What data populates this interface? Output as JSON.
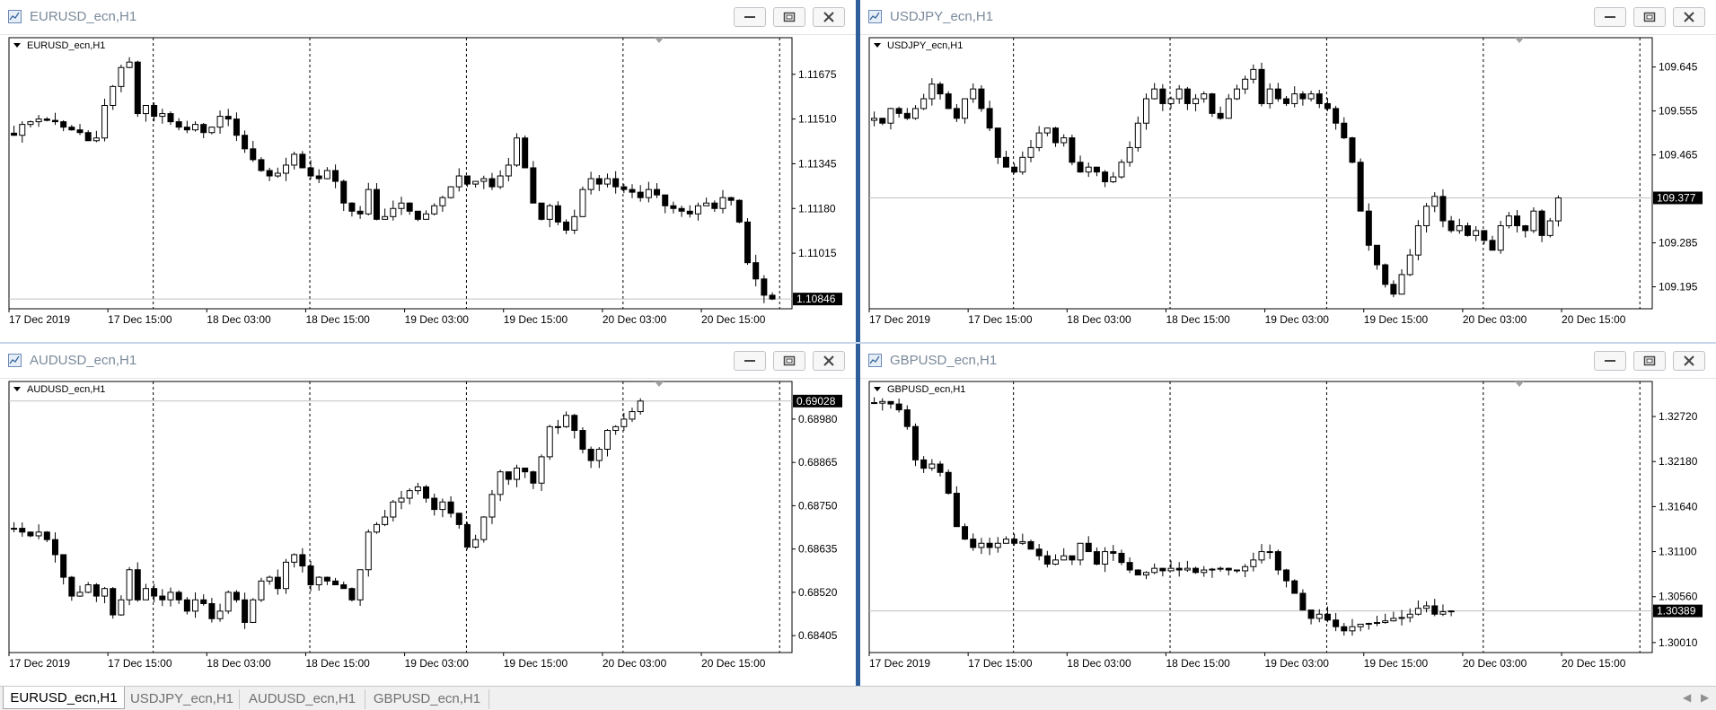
{
  "windows": [
    {
      "title": "EURUSD_ecn,H1",
      "chart_label": "EURUSD_ecn,H1",
      "current_price": "1.10846",
      "price_ticks": [
        "1.11675",
        "1.11510",
        "1.11345",
        "1.11180",
        "1.11015"
      ],
      "time_ticks": [
        "17 Dec 2019",
        "17 Dec 15:00",
        "18 Dec 03:00",
        "18 Dec 15:00",
        "19 Dec 03:00",
        "19 Dec 15:00",
        "20 Dec 03:00",
        "20 Dec 15:00"
      ]
    },
    {
      "title": "USDJPY_ecn,H1",
      "chart_label": "USDJPY_ecn,H1",
      "current_price": "109.377",
      "price_ticks": [
        "109.645",
        "109.555",
        "109.465",
        "109.285",
        "109.195"
      ],
      "time_ticks": [
        "17 Dec 2019",
        "17 Dec 15:00",
        "18 Dec 03:00",
        "18 Dec 15:00",
        "19 Dec 03:00",
        "19 Dec 15:00",
        "20 Dec 03:00",
        "20 Dec 15:00"
      ]
    },
    {
      "title": "AUDUSD_ecn,H1",
      "chart_label": "AUDUSD_ecn,H1",
      "current_price": "0.69028",
      "price_ticks": [
        "0.68980",
        "0.68865",
        "0.68750",
        "0.68635",
        "0.68520",
        "0.68405"
      ],
      "time_ticks": [
        "17 Dec 2019",
        "17 Dec 15:00",
        "18 Dec 03:00",
        "18 Dec 15:00",
        "19 Dec 03:00",
        "19 Dec 15:00",
        "20 Dec 03:00",
        "20 Dec 15:00"
      ]
    },
    {
      "title": "GBPUSD_ecn,H1",
      "chart_label": "GBPUSD_ecn,H1",
      "current_price": "1.30389",
      "price_ticks": [
        "1.32720",
        "1.32180",
        "1.31640",
        "1.31100",
        "1.30560",
        "1.30010"
      ],
      "time_ticks": [
        "17 Dec 2019",
        "17 Dec 15:00",
        "18 Dec 03:00",
        "18 Dec 15:00",
        "19 Dec 03:00",
        "19 Dec 15:00",
        "20 Dec 03:00",
        "20 Dec 15:00"
      ]
    }
  ],
  "tabs": [
    "EURUSD_ecn,H1",
    "USDJPY_ecn,H1",
    "AUDUSD_ecn,H1",
    "GBPUSD_ecn,H1"
  ],
  "active_tab": 0,
  "colors": {
    "accent": "#2f5f9a",
    "candle": "#000000",
    "grid": "#000000",
    "background": "#ffffff"
  },
  "icons": [
    "chart-window-icon",
    "minimize-icon",
    "restore-icon",
    "close-icon",
    "collapse-triangle-icon"
  ],
  "chart_data": [
    {
      "type": "candlestick",
      "series": [
        {
          "name": "EURUSD_ecn,H1",
          "close": [
            1.1145,
            1.1149,
            1.115,
            1.1151,
            1.11505,
            1.115,
            1.1148,
            1.1147,
            1.1146,
            1.1143,
            1.1144,
            1.1156,
            1.1163,
            1.117,
            1.1172,
            1.1153,
            1.1156,
            1.1152,
            1.1153,
            1.115,
            1.1148,
            1.1147,
            1.1149,
            1.1146,
            1.1148,
            1.1152,
            1.1151,
            1.1145,
            1.114,
            1.1136,
            1.1132,
            1.113,
            1.1131,
            1.1134,
            1.1138,
            1.1133,
            1.113,
            1.1129,
            1.1132,
            1.1128,
            1.112,
            1.1117,
            1.1116,
            1.1125,
            1.1114,
            1.1115,
            1.1118,
            1.112,
            1.1117,
            1.1114,
            1.1116,
            1.1119,
            1.1122,
            1.1126,
            1.113,
            1.1127,
            1.1128,
            1.1129,
            1.1126,
            1.113,
            1.1134,
            1.1144,
            1.1133,
            1.112,
            1.1114,
            1.1119,
            1.1113,
            1.111,
            1.1115,
            1.1125,
            1.1129,
            1.1127,
            1.1129,
            1.1126,
            1.1125,
            1.1124,
            1.1122,
            1.1125,
            1.1123,
            1.1119,
            1.1118,
            1.1117,
            1.1116,
            1.1119,
            1.112,
            1.1118,
            1.1122,
            1.1121,
            1.1113,
            1.1098,
            1.1092,
            1.1086,
            1.10846
          ]
        }
      ],
      "ylim": [
        1.1081,
        1.1181
      ],
      "x_labels": [
        "17 Dec 2019",
        "17 Dec 15:00",
        "18 Dec 03:00",
        "18 Dec 15:00",
        "19 Dec 03:00",
        "19 Dec 15:00",
        "20 Dec 03:00",
        "20 Dec 15:00"
      ]
    },
    {
      "type": "candlestick",
      "series": [
        {
          "name": "USDJPY_ecn,H1",
          "close": [
            109.54,
            109.53,
            109.56,
            109.55,
            109.54,
            109.56,
            109.58,
            109.61,
            109.59,
            109.56,
            109.54,
            109.58,
            109.6,
            109.56,
            109.52,
            109.46,
            109.44,
            109.43,
            109.46,
            109.48,
            109.51,
            109.52,
            109.49,
            109.5,
            109.45,
            109.43,
            109.44,
            109.43,
            109.41,
            109.42,
            109.45,
            109.48,
            109.53,
            109.58,
            109.6,
            109.57,
            109.58,
            109.6,
            109.57,
            109.58,
            109.59,
            109.55,
            109.54,
            109.58,
            109.6,
            109.62,
            109.64,
            109.57,
            109.6,
            109.58,
            109.57,
            109.59,
            109.58,
            109.59,
            109.57,
            109.56,
            109.53,
            109.5,
            109.45,
            109.35,
            109.28,
            109.24,
            109.2,
            109.18,
            109.22,
            109.26,
            109.32,
            109.36,
            109.38,
            109.33,
            109.31,
            109.32,
            109.3,
            109.31,
            109.29,
            109.27,
            109.32,
            109.34,
            109.32,
            109.31,
            109.35,
            109.3,
            109.33,
            109.377
          ]
        }
      ],
      "ylim": [
        109.15,
        109.705
      ],
      "x_labels": [
        "17 Dec 2019",
        "17 Dec 15:00",
        "18 Dec 03:00",
        "18 Dec 15:00",
        "19 Dec 03:00",
        "19 Dec 15:00",
        "20 Dec 03:00",
        "20 Dec 15:00"
      ]
    },
    {
      "type": "candlestick",
      "series": [
        {
          "name": "AUDUSD_ecn,H1",
          "close": [
            0.6869,
            0.6868,
            0.6867,
            0.6868,
            0.6866,
            0.6862,
            0.6856,
            0.6851,
            0.6852,
            0.6854,
            0.6851,
            0.6853,
            0.6846,
            0.685,
            0.6858,
            0.685,
            0.6853,
            0.6851,
            0.685,
            0.6852,
            0.685,
            0.6847,
            0.685,
            0.6849,
            0.6845,
            0.6847,
            0.6852,
            0.685,
            0.6844,
            0.685,
            0.6855,
            0.6856,
            0.6853,
            0.686,
            0.6862,
            0.6859,
            0.6854,
            0.6856,
            0.6855,
            0.6854,
            0.6853,
            0.685,
            0.6858,
            0.6868,
            0.687,
            0.6872,
            0.6876,
            0.6877,
            0.6879,
            0.688,
            0.6877,
            0.6874,
            0.6876,
            0.6873,
            0.687,
            0.6864,
            0.6866,
            0.6872,
            0.6878,
            0.6884,
            0.6882,
            0.6885,
            0.6884,
            0.6881,
            0.6888,
            0.6896,
            0.6896,
            0.6899,
            0.6895,
            0.689,
            0.6887,
            0.689,
            0.6895,
            0.6896,
            0.6898,
            0.69,
            0.69028
          ]
        }
      ],
      "ylim": [
        0.6836,
        0.6908
      ],
      "x_labels": [
        "17 Dec 2019",
        "17 Dec 15:00",
        "18 Dec 03:00",
        "18 Dec 15:00",
        "19 Dec 03:00",
        "19 Dec 15:00",
        "20 Dec 03:00",
        "20 Dec 15:00"
      ]
    },
    {
      "type": "candlestick",
      "series": [
        {
          "name": "GBPUSD_ecn,H1",
          "close": [
            1.3288,
            1.329,
            1.3287,
            1.328,
            1.326,
            1.322,
            1.321,
            1.3215,
            1.3205,
            1.318,
            1.314,
            1.3125,
            1.3115,
            1.312,
            1.3115,
            1.312,
            1.3125,
            1.312,
            1.3122,
            1.3113,
            1.3105,
            1.3095,
            1.31,
            1.3105,
            1.31,
            1.312,
            1.311,
            1.3095,
            1.311,
            1.3108,
            1.3097,
            1.3088,
            1.3082,
            1.3085,
            1.309,
            1.3087,
            1.309,
            1.3088,
            1.309,
            1.3085,
            1.3088,
            1.3089,
            1.309,
            1.3088,
            1.3087,
            1.3092,
            1.31,
            1.311,
            1.311,
            1.3088,
            1.3075,
            1.306,
            1.304,
            1.303,
            1.3035,
            1.3028,
            1.302,
            1.3015,
            1.302,
            1.3023,
            1.3024,
            1.3025,
            1.3027,
            1.303,
            1.3031,
            1.3035,
            1.3042,
            1.3045,
            1.3035,
            1.3038,
            1.30389
          ]
        }
      ],
      "ylim": [
        1.2989,
        1.3314
      ],
      "x_labels": [
        "17 Dec 2019",
        "17 Dec 15:00",
        "18 Dec 03:00",
        "18 Dec 15:00",
        "19 Dec 03:00",
        "19 Dec 15:00",
        "20 Dec 03:00",
        "20 Dec 15:00"
      ]
    }
  ]
}
